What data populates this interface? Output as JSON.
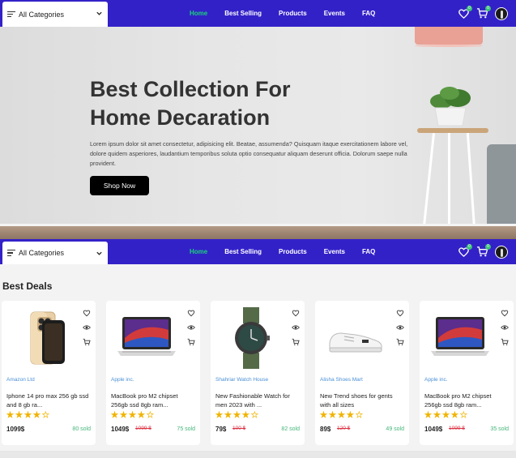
{
  "nav": {
    "categories_label": "All Categories",
    "links": [
      "Home",
      "Best Selling",
      "Products",
      "Events",
      "FAQ"
    ],
    "active": "Home",
    "wishlist_count": "0",
    "cart_count": "0"
  },
  "hero": {
    "title_line1": "Best Collection For",
    "title_line2": "Home Decaration",
    "description": "Lorem ipsum dolor sit amet consectetur, adipisicing elit. Beatae, assumenda? Quisquam itaque exercitationem labore vel, dolore quidem asperiores, laudantium temporibus soluta optio consequatur aliquam deserunt officia. Dolorum saepe nulla provident.",
    "button": "Shop Now"
  },
  "deals": {
    "title": "Best Deals",
    "products": [
      {
        "shop": "Amazon Ltd",
        "name": "Iphone 14 pro max 256 gb ssd and 8 gb ra...",
        "price": "1099$",
        "old_price": "",
        "sold": "80 sold",
        "rating": 4,
        "image": "iphone"
      },
      {
        "shop": "Apple inc.",
        "name": "MacBook pro M2 chipset 256gb ssd 8gb ram...",
        "price": "1049$",
        "old_price": "1099 $",
        "sold": "75 sold",
        "rating": 4,
        "image": "laptop"
      },
      {
        "shop": "Shahriar Watch House",
        "name": "New Fashionable Watch for men 2023 with ...",
        "price": "79$",
        "old_price": "100 $",
        "sold": "82 sold",
        "rating": 4,
        "image": "watch"
      },
      {
        "shop": "Alisha Shoes Mart",
        "name": "New Trend shoes for gents with all sizes",
        "price": "89$",
        "old_price": "120 $",
        "sold": "49 sold",
        "rating": 4,
        "image": "shoe"
      },
      {
        "shop": "Apple inc.",
        "name": "MacBook pro M2 chipset 256gb ssd 8gb ram...",
        "price": "1049$",
        "old_price": "1099 $",
        "sold": "35 sold",
        "rating": 4,
        "image": "laptop"
      }
    ]
  },
  "colors": {
    "nav_bg": "#3321c8",
    "active_link": "#19d27a",
    "star": "#f0b400",
    "shop_name": "#4a8fd6",
    "sold": "#44b57a",
    "old_price": "#d34"
  }
}
